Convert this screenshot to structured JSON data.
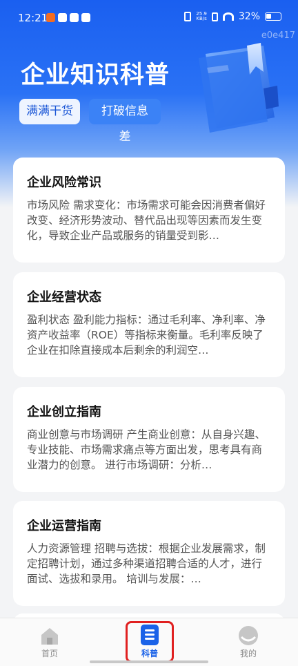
{
  "status_bar": {
    "time": "12:21",
    "net_speed_value": "25.9",
    "net_speed_unit": "KB/s",
    "battery": "32%"
  },
  "watermark": "e0e417",
  "header": {
    "title": "企业知识科普",
    "tags": [
      "满满干货",
      "打破信息差"
    ]
  },
  "cards": [
    {
      "title": "企业风险常识",
      "desc": "市场风险 需求变化：市场需求可能会因消费者偏好改变、经济形势波动、替代品出现等因素而发生变化，导致企业产品或服务的销量受到影…"
    },
    {
      "title": "企业经营状态",
      "desc": "盈利状态 盈利能力指标：通过毛利率、净利率、净资产收益率（ROE）等指标来衡量。毛利率反映了企业在扣除直接成本后剩余的利润空…"
    },
    {
      "title": "企业创立指南",
      "desc": "商业创意与市场调研 产生商业创意：从自身兴趣、专业技能、市场需求痛点等方面出发，思考具有商业潜力的创意。 进行市场调研：分析…"
    },
    {
      "title": "企业运营指南",
      "desc": "人力资源管理 招聘与选拔：根据企业发展需求，制定招聘计划，通过多种渠道招聘合适的人才，进行面试、选拔和录用。 培训与发展：…"
    }
  ],
  "bottom_nav": {
    "items": [
      {
        "label": "首页",
        "icon": "home-icon"
      },
      {
        "label": "科普",
        "icon": "bookmark-doc-icon"
      },
      {
        "label": "我的",
        "icon": "profile-icon"
      }
    ],
    "active_index": 1
  },
  "colors": {
    "primary": "#1a62e8",
    "highlight": "#e02020"
  }
}
